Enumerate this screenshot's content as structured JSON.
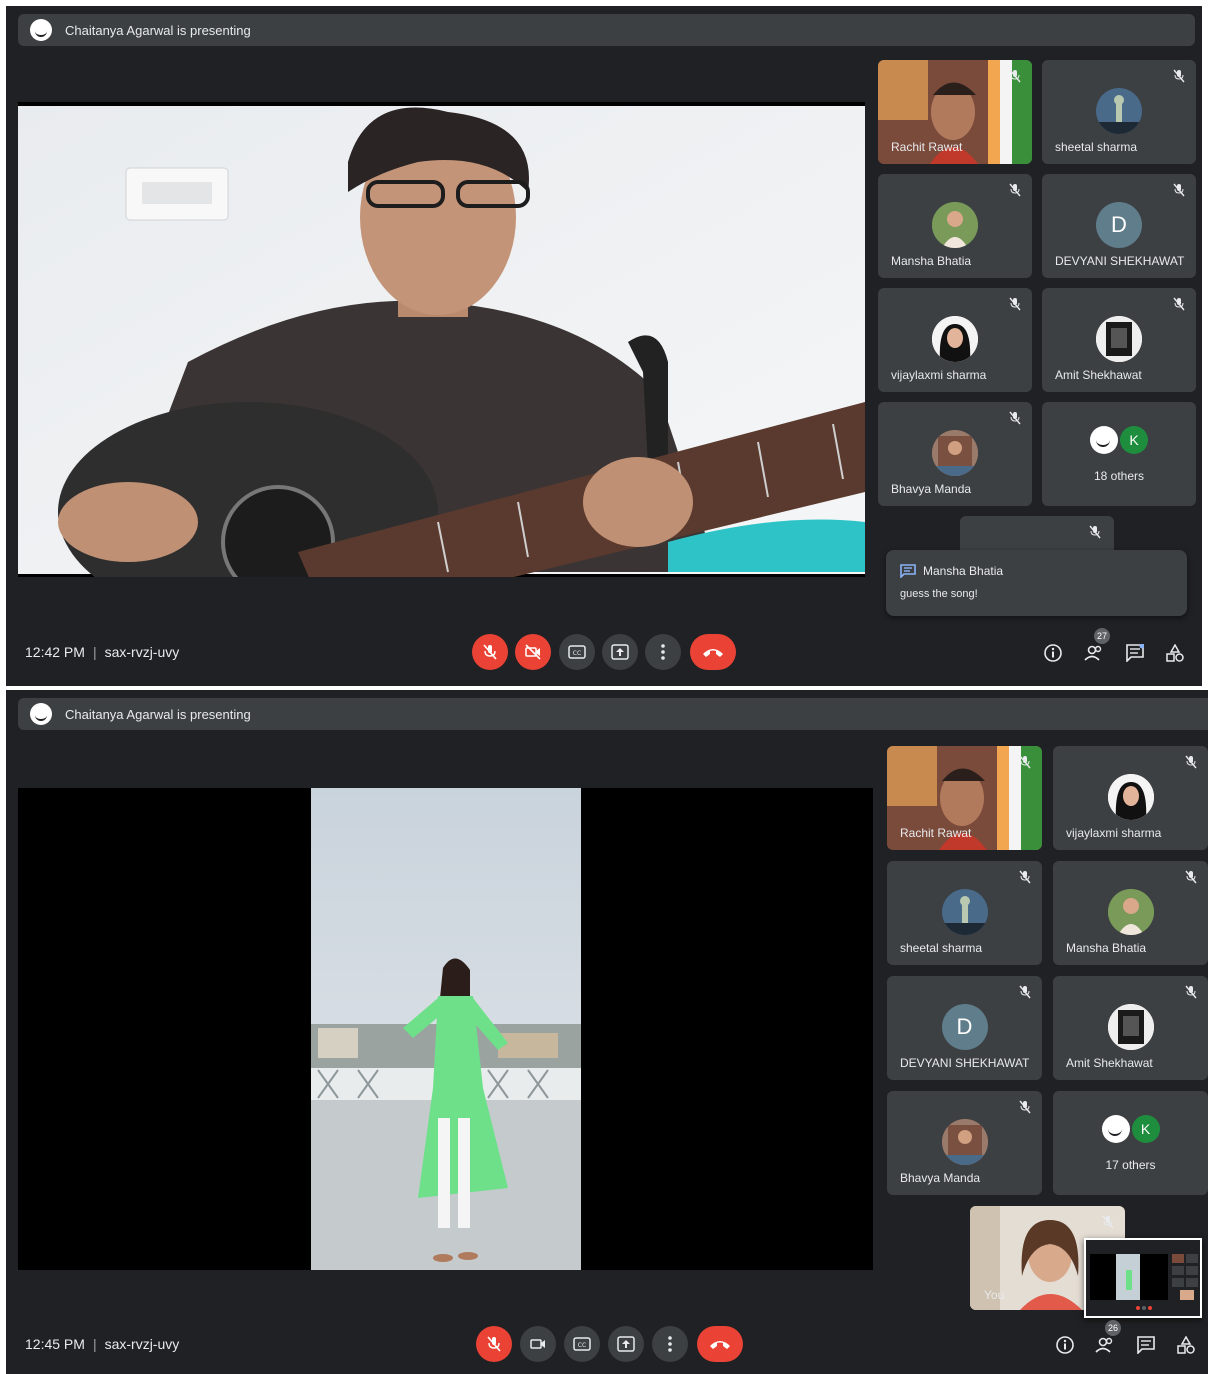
{
  "screens": [
    {
      "presenting_text": "Chaitanya Agarwal is presenting",
      "time": "12:42 PM",
      "meeting_code": "sax-rvzj-uvy",
      "participants": [
        "Rachit Rawat",
        "sheetal sharma",
        "Mansha Bhatia",
        "DEVYANI SHEKHAWAT",
        "vijaylaxmi sharma",
        "Amit Shekhawat",
        "Bhavya Manda"
      ],
      "devyani_initial": "D",
      "others_initial": "K",
      "others_label": "18 others",
      "people_count": "27",
      "chat": {
        "sender": "Mansha Bhatia",
        "message": "guess the song!"
      },
      "controls": {
        "mic": "muted",
        "camera": "off"
      }
    },
    {
      "presenting_text": "Chaitanya Agarwal is presenting",
      "time": "12:45 PM",
      "meeting_code": "sax-rvzj-uvy",
      "participants": [
        "Rachit Rawat",
        "vijaylaxmi sharma",
        "sheetal sharma",
        "Mansha Bhatia",
        "DEVYANI SHEKHAWAT",
        "Amit Shekhawat",
        "Bhavya Manda"
      ],
      "devyani_initial": "D",
      "others_initial": "K",
      "others_label": "17 others",
      "self_label": "You",
      "people_count": "26",
      "controls": {
        "mic": "muted",
        "camera": "on"
      }
    }
  ],
  "colors": {
    "background": "#202124",
    "tile": "#3c4043",
    "danger": "#ea4335",
    "text": "#e8eaed"
  },
  "icons": [
    "mic-off-icon",
    "camera-off-icon",
    "camera-icon",
    "captions-icon",
    "present-icon",
    "more-vert-icon",
    "end-call-icon",
    "info-icon",
    "people-icon",
    "chat-icon",
    "activities-icon"
  ]
}
